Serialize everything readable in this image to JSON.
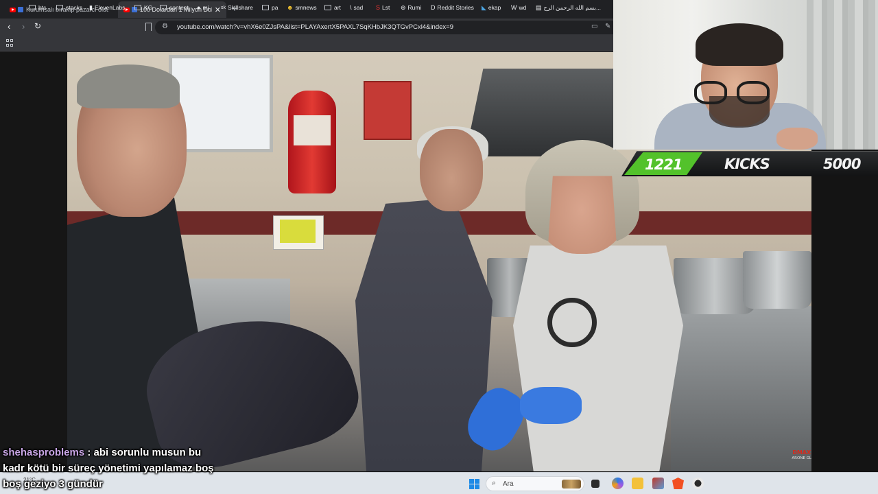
{
  "browser": {
    "tabs": [
      {
        "title": "Kurumsalı bırakıp pazarcı oldu: \"C",
        "active": false
      },
      {
        "title": "100 Dolardan 1 Milyon Dolar",
        "active": true
      }
    ],
    "url": "youtube.com/watch?v=vhX6e0ZJsPA&list=PLAYAxertX5PAXL7SqKHbJK3QTGvPCxl4&index=9",
    "bookmarks": [
      "btc",
      "stocks",
      "ElevenLabs",
      "KG",
      "content",
      "mj",
      "Skillshare",
      "pa",
      "smnews",
      "art",
      "sad",
      "Lst",
      "Rumi",
      "Reddit Stories",
      "ekap",
      "wd",
      "بسم الله الرحمن الرح..."
    ]
  },
  "stream_overlay": {
    "kicks_count": "1221",
    "kicks_label": "KICKS",
    "kicks_goal": "5000",
    "watermark": "DMAX",
    "watermark_sub": "ARONE GL"
  },
  "chat": {
    "username": "shehasproblems",
    "message_line1": ": abi sorunlu musun bu",
    "message_line2": "kadr kötü bir süreç yönetimi yapılamaz boş",
    "message_line3": "boş geziyo 3 gündür"
  },
  "taskbar": {
    "weather": "21°C",
    "search_placeholder": "Ara"
  },
  "colors": {
    "kicks_green": "#53c22b",
    "chat_username": "#c9a6e6"
  }
}
